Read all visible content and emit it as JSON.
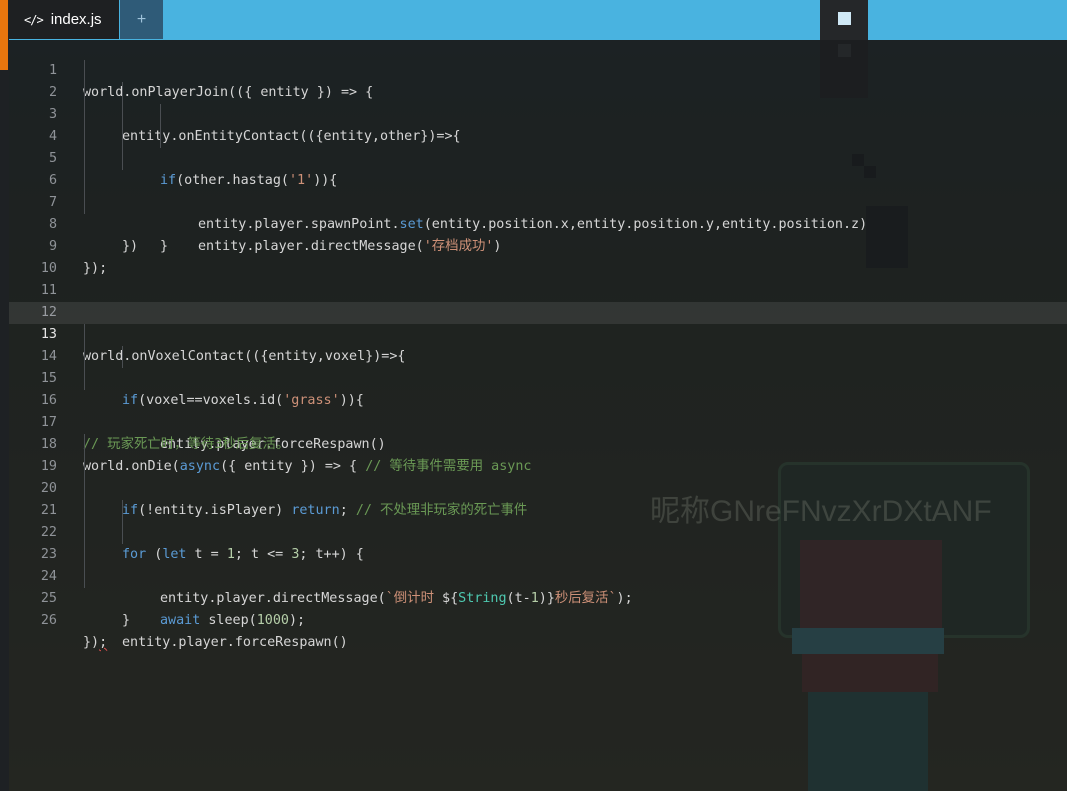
{
  "tabs": {
    "file_icon": "</>",
    "file_name": "index.js",
    "add_label": "+"
  },
  "editor": {
    "current_line": 13,
    "line_numbers": [
      "1",
      "2",
      "3",
      "4",
      "5",
      "6",
      "7",
      "8",
      "9",
      "10",
      "11",
      "12",
      "13",
      "14",
      "15",
      "16",
      "17",
      "18",
      "19",
      "20",
      "21",
      "22",
      "23",
      "24",
      "25",
      "26"
    ],
    "l1": [
      "world.onPlayerJoin(({ entity }) => {"
    ],
    "l2": [
      "entity.onEntityContact(({entity,other})=>{"
    ],
    "l3": [
      "if",
      "(other.hastag(",
      "'1'",
      ")){"
    ],
    "l4": [
      "entity.player.spawnPoint.",
      "set",
      "(entity.position.x,entity.position.y,entity.position.z)"
    ],
    "l5": [
      "entity.player.directMessage(",
      "'存档成功'",
      ")"
    ],
    "l6": [
      "}"
    ],
    "l7": [
      "})"
    ],
    "l9": [
      "});"
    ],
    "l13": [
      "world.onVoxelContact(({entity,voxel})=>{"
    ],
    "l14": [
      "if",
      "(voxel==voxels.id(",
      "'grass'",
      ")){"
    ],
    "l15": [
      "entity.player.forceRespawn()"
    ],
    "l17": [
      "// 玩家死亡时，等待3秒后复活。"
    ],
    "l18": [
      "world.onDie(",
      "async",
      "({ entity }) => { ",
      "// 等待事件需要用 async"
    ],
    "l19": [
      "if",
      "(!entity.isPlayer) ",
      "return",
      "; ",
      "// 不处理非玩家的死亡事件"
    ],
    "l21": [
      "for",
      " (",
      "let",
      " t = ",
      "1",
      "; t <= ",
      "3",
      "; t++) {"
    ],
    "l22": [
      "entity.player.directMessage(",
      "`倒计时 ",
      "${",
      "String",
      "(t-",
      "1",
      ")",
      "}",
      "秒后复活`",
      ");"
    ],
    "l23": [
      "await",
      " sleep(",
      "1000",
      ");"
    ],
    "l24": [
      "}"
    ],
    "l25": [
      "entity.player.forceRespawn()"
    ],
    "l26": [
      "})",
      ";"
    ]
  },
  "scene": {
    "watermark": "昵称GNreFNvzXrDXtANF"
  },
  "colors": {
    "keyword": "#5b9bd5",
    "string": "#ce9178",
    "comment": "#6a9955",
    "type": "#4ec9b0",
    "number": "#b5cea8",
    "accent": "#e8760e"
  }
}
